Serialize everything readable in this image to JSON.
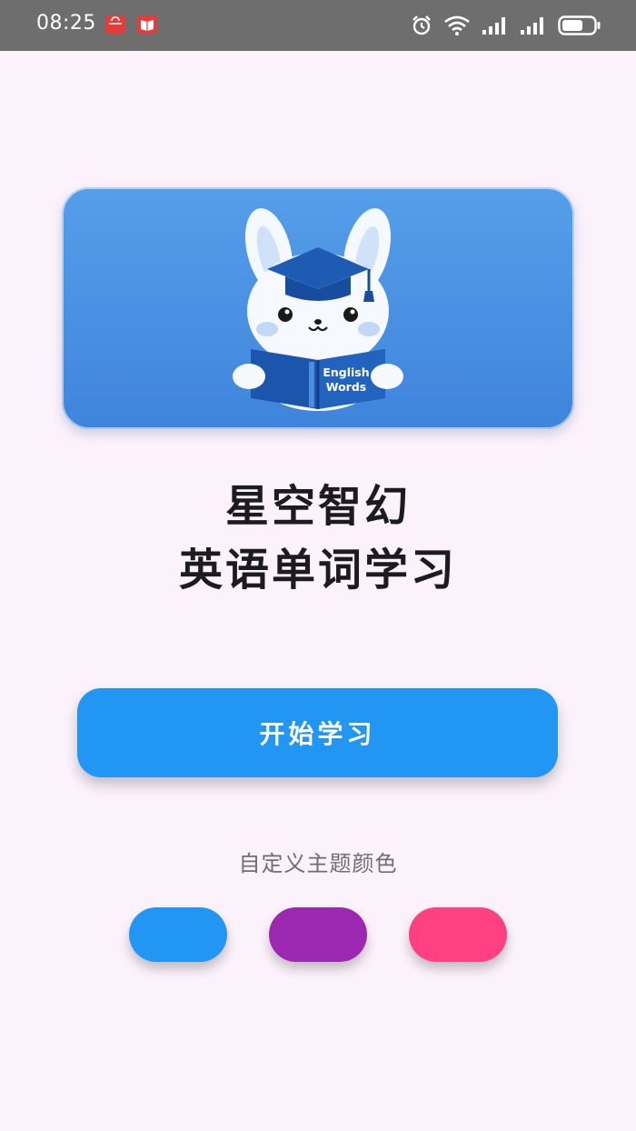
{
  "status_bar": {
    "time": "08:25",
    "notification_icons": [
      "shop-app-icon",
      "book-app-icon"
    ],
    "system_icons": [
      "alarm-icon",
      "wifi-icon",
      "signal-icon",
      "signal-icon",
      "battery-icon"
    ]
  },
  "hero": {
    "book_text_line1": "English",
    "book_text_line2": "Words"
  },
  "title": {
    "line1": "星空智幻",
    "line2": "英语单词学习"
  },
  "start_button": {
    "label": "开始学习"
  },
  "theme": {
    "label": "自定义主题颜色",
    "colors": [
      "#2196F3",
      "#9C27B0",
      "#FF4081"
    ]
  }
}
